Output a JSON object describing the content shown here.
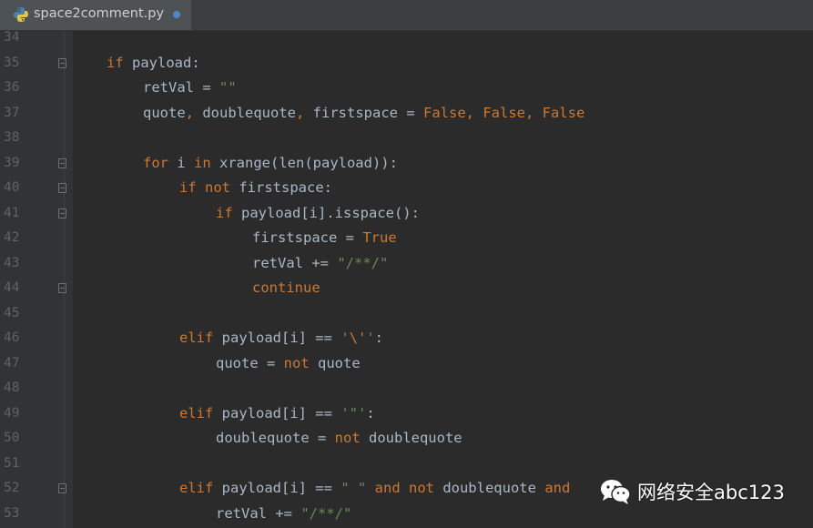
{
  "tab": {
    "filename": "space2comment.py",
    "icon": "python-file-icon",
    "modified": true
  },
  "lines": [
    {
      "n": "34",
      "indent": 0,
      "tokens": []
    },
    {
      "n": "35",
      "indent": 2,
      "fold": true,
      "tokens": [
        {
          "t": "if",
          "c": "kw"
        },
        {
          "t": " payload:",
          "c": "id"
        }
      ]
    },
    {
      "n": "36",
      "indent": 3,
      "tokens": [
        {
          "t": "retVal = ",
          "c": "id"
        },
        {
          "t": "\"\"",
          "c": "str"
        }
      ]
    },
    {
      "n": "37",
      "indent": 3,
      "tokens": [
        {
          "t": "quote",
          "c": "id"
        },
        {
          "t": ",",
          "c": "kw"
        },
        {
          "t": " doublequote",
          "c": "id"
        },
        {
          "t": ",",
          "c": "kw"
        },
        {
          "t": " firstspace = ",
          "c": "id"
        },
        {
          "t": "False, False, False",
          "c": "kw"
        }
      ]
    },
    {
      "n": "38",
      "indent": 0,
      "tokens": []
    },
    {
      "n": "39",
      "indent": 3,
      "fold": true,
      "tokens": [
        {
          "t": "for",
          "c": "kw"
        },
        {
          "t": " i ",
          "c": "id"
        },
        {
          "t": "in",
          "c": "kw"
        },
        {
          "t": " xrange(len(payload)):",
          "c": "id"
        }
      ]
    },
    {
      "n": "40",
      "indent": 4,
      "fold": true,
      "tokens": [
        {
          "t": "if not",
          "c": "kw"
        },
        {
          "t": " firstspace:",
          "c": "id"
        }
      ]
    },
    {
      "n": "41",
      "indent": 5,
      "fold": true,
      "tokens": [
        {
          "t": "if",
          "c": "kw"
        },
        {
          "t": " payload[i].isspace():",
          "c": "id"
        }
      ]
    },
    {
      "n": "42",
      "indent": 6,
      "tokens": [
        {
          "t": "firstspace = ",
          "c": "id"
        },
        {
          "t": "True",
          "c": "kw"
        }
      ]
    },
    {
      "n": "43",
      "indent": 6,
      "tokens": [
        {
          "t": "retVal += ",
          "c": "id"
        },
        {
          "t": "\"/**/\"",
          "c": "str"
        }
      ]
    },
    {
      "n": "44",
      "indent": 6,
      "fold": true,
      "tokens": [
        {
          "t": "continue",
          "c": "kw"
        }
      ]
    },
    {
      "n": "45",
      "indent": 0,
      "tokens": []
    },
    {
      "n": "46",
      "indent": 4,
      "tokens": [
        {
          "t": "elif",
          "c": "kw"
        },
        {
          "t": " payload[i] == ",
          "c": "id"
        },
        {
          "t": "'",
          "c": "str"
        },
        {
          "t": "\\'",
          "c": "esc"
        },
        {
          "t": "'",
          "c": "str"
        },
        {
          "t": ":",
          "c": "id"
        }
      ]
    },
    {
      "n": "47",
      "indent": 5,
      "tokens": [
        {
          "t": "quote = ",
          "c": "id"
        },
        {
          "t": "not",
          "c": "kw"
        },
        {
          "t": " quote",
          "c": "id"
        }
      ]
    },
    {
      "n": "48",
      "indent": 0,
      "tokens": []
    },
    {
      "n": "49",
      "indent": 4,
      "tokens": [
        {
          "t": "elif",
          "c": "kw"
        },
        {
          "t": " payload[i] == ",
          "c": "id"
        },
        {
          "t": "'\"'",
          "c": "str"
        },
        {
          "t": ":",
          "c": "id"
        }
      ]
    },
    {
      "n": "50",
      "indent": 5,
      "tokens": [
        {
          "t": "doublequote = ",
          "c": "id"
        },
        {
          "t": "not",
          "c": "kw"
        },
        {
          "t": " doublequote",
          "c": "id"
        }
      ]
    },
    {
      "n": "51",
      "indent": 0,
      "tokens": []
    },
    {
      "n": "52",
      "indent": 4,
      "fold": true,
      "tokens": [
        {
          "t": "elif",
          "c": "kw"
        },
        {
          "t": " payload[i] == ",
          "c": "id"
        },
        {
          "t": "\" \"",
          "c": "str"
        },
        {
          "t": " ",
          "c": "id"
        },
        {
          "t": "and not",
          "c": "kw"
        },
        {
          "t": " doublequote ",
          "c": "id"
        },
        {
          "t": "and",
          "c": "kw"
        }
      ]
    },
    {
      "n": "53",
      "indent": 5,
      "tokens": [
        {
          "t": "retVal += ",
          "c": "id"
        },
        {
          "t": "\"/**/\"",
          "c": "str"
        }
      ]
    }
  ],
  "watermark": {
    "text": "网络安全abc123",
    "icon": "wechat-icon"
  },
  "colors": {
    "keyword": "#cc7832",
    "identifier": "#a9b7c6",
    "string": "#6a8759",
    "line_number": "#606366",
    "background": "#2b2b2b"
  }
}
